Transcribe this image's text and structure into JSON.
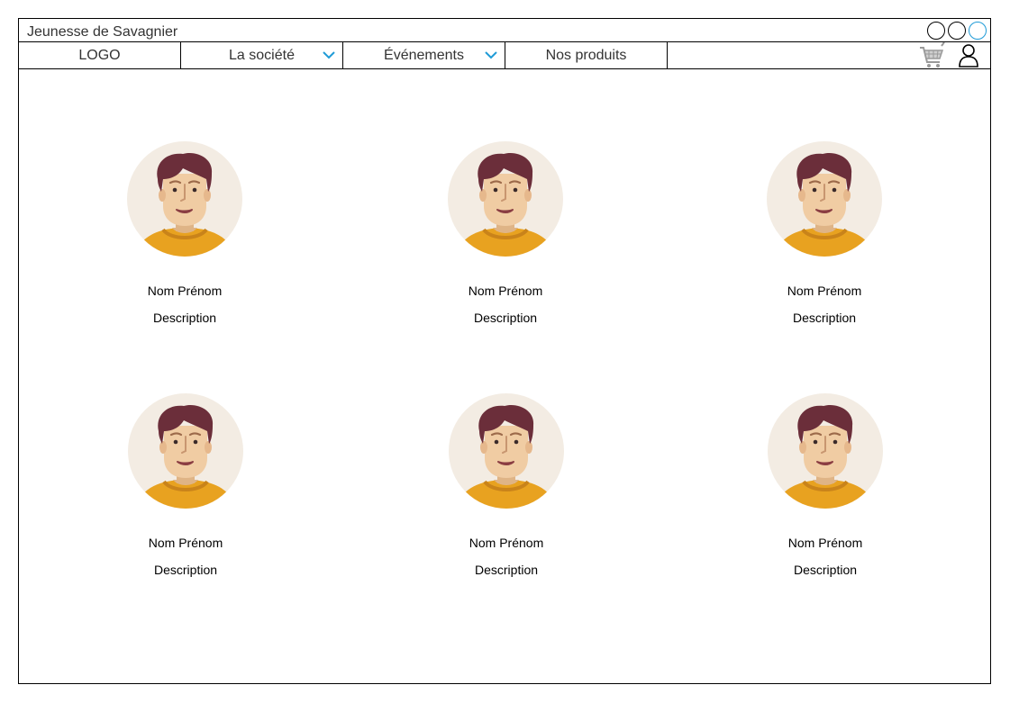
{
  "window": {
    "title": "Jeunesse de Savagnier",
    "controls": [
      "minimize",
      "restore",
      "maximize"
    ]
  },
  "nav": {
    "logo": "LOGO",
    "items": [
      {
        "label": "La société",
        "has_dropdown": true
      },
      {
        "label": "Événements",
        "has_dropdown": true
      },
      {
        "label": "Nos produits",
        "has_dropdown": false
      }
    ],
    "icons": [
      "cart-icon",
      "user-icon"
    ]
  },
  "profiles": [
    {
      "name": "Nom Prénom",
      "description": "Description"
    },
    {
      "name": "Nom Prénom",
      "description": "Description"
    },
    {
      "name": "Nom Prénom",
      "description": "Description"
    },
    {
      "name": "Nom Prénom",
      "description": "Description"
    },
    {
      "name": "Nom Prénom",
      "description": "Description"
    },
    {
      "name": "Nom Prénom",
      "description": "Description"
    }
  ],
  "colors": {
    "accent": "#1f9bd7",
    "avatar_bg": "#f3ece3",
    "shirt": "#e8a220",
    "hair": "#6b2e3a",
    "skin": "#f0cca3"
  }
}
